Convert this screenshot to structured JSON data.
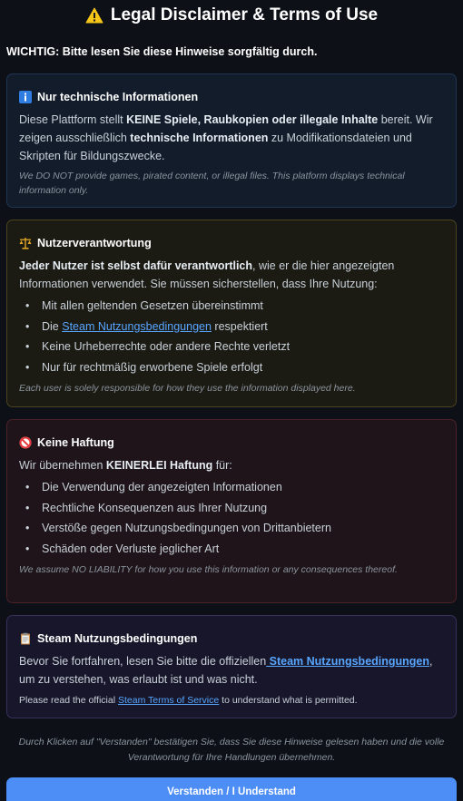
{
  "title": "Legal Disclaimer & Terms of Use",
  "intro": "WICHTIG: Bitte lesen Sie diese Hinweise sorgfältig durch.",
  "colors": {
    "accent": "#4c8df6",
    "link": "#58a6ff",
    "warning": "#f5c518"
  },
  "tech_card": {
    "icon": "info-icon",
    "title": "Nur technische Informationen",
    "p_1": "Diese Plattform stellt ",
    "p_2": "KEINE Spiele, Raubkopien oder illegale Inhalte",
    "p_3": " bereit. Wir zeigen ausschließlich ",
    "p_4": "technische Informationen",
    "p_5": " zu Modifikationsdateien und Skripten für Bildungszwecke.",
    "en": "We DO NOT provide games, pirated content, or illegal files. This platform displays technical information only."
  },
  "user_card": {
    "icon": "scales-icon",
    "title": "Nutzerverantwortung",
    "p_1": "Jeder Nutzer ist selbst dafür verantwortlich",
    "p_2": ", wie er die hier angezeigten Informationen verwendet. Sie müssen sicherstellen, dass Ihre Nutzung:",
    "items": {
      "i0": "Mit allen geltenden Gesetzen übereinstimmt",
      "i1_pre": "Die ",
      "i1_link": "Steam Nutzungsbedingungen",
      "i1_post": " respektiert",
      "i2": "Keine Urheberrechte oder andere Rechte verletzt",
      "i3": "Nur für rechtmäßig erworbene Spiele erfolgt"
    },
    "en": "Each user is solely responsible for how they use the information displayed here."
  },
  "liability_card": {
    "icon": "prohibited-icon",
    "title": "Keine Haftung",
    "p_1": "Wir übernehmen ",
    "p_2": "KEINERLEI Haftung",
    "p_3": " für:",
    "items": [
      "Die Verwendung der angezeigten Informationen",
      "Rechtliche Konsequenzen aus Ihrer Nutzung",
      "Verstöße gegen Nutzungsbedingungen von Drittanbietern",
      "Schäden oder Verluste jeglicher Art"
    ],
    "en": "We assume NO LIABILITY for how you use this information or any consequences thereof."
  },
  "steam_card": {
    "icon": "clipboard-icon",
    "title": "Steam Nutzungsbedingungen",
    "p_1": "Bevor Sie fortfahren, lesen Sie bitte die offiziellen",
    "p_link": " Steam Nutzungsbedingungen",
    "p_2": ", um zu verstehen, was erlaubt ist und was nicht.",
    "en_1": "Please read the official ",
    "en_link": "Steam Terms of Service",
    "en_2": " to understand what is permitted."
  },
  "bullet": "•",
  "footer": "Durch Klicken auf \"Verstanden\" bestätigen Sie, dass Sie diese Hinweise gelesen haben und die volle Verantwortung für Ihre Handlungen übernehmen.",
  "accept_button": "Verstanden / I Understand"
}
